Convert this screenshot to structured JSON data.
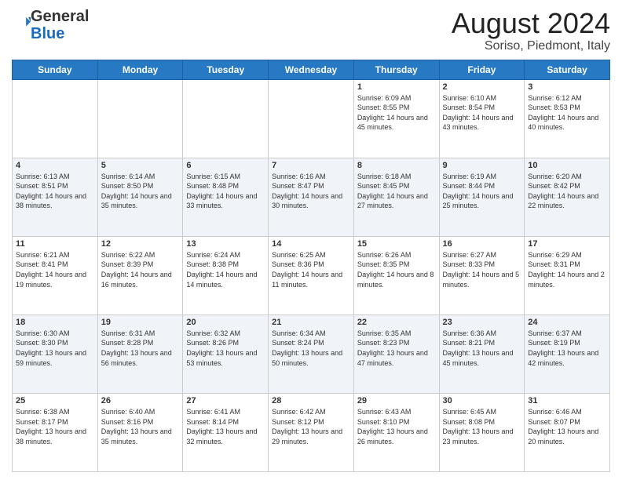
{
  "header": {
    "logo_general": "General",
    "logo_blue": "Blue",
    "month_year": "August 2024",
    "location": "Soriso, Piedmont, Italy"
  },
  "days_of_week": [
    "Sunday",
    "Monday",
    "Tuesday",
    "Wednesday",
    "Thursday",
    "Friday",
    "Saturday"
  ],
  "weeks": [
    [
      {
        "day": "",
        "info": ""
      },
      {
        "day": "",
        "info": ""
      },
      {
        "day": "",
        "info": ""
      },
      {
        "day": "",
        "info": ""
      },
      {
        "day": "1",
        "info": "Sunrise: 6:09 AM\nSunset: 8:55 PM\nDaylight: 14 hours and 45 minutes."
      },
      {
        "day": "2",
        "info": "Sunrise: 6:10 AM\nSunset: 8:54 PM\nDaylight: 14 hours and 43 minutes."
      },
      {
        "day": "3",
        "info": "Sunrise: 6:12 AM\nSunset: 8:53 PM\nDaylight: 14 hours and 40 minutes."
      }
    ],
    [
      {
        "day": "4",
        "info": "Sunrise: 6:13 AM\nSunset: 8:51 PM\nDaylight: 14 hours and 38 minutes."
      },
      {
        "day": "5",
        "info": "Sunrise: 6:14 AM\nSunset: 8:50 PM\nDaylight: 14 hours and 35 minutes."
      },
      {
        "day": "6",
        "info": "Sunrise: 6:15 AM\nSunset: 8:48 PM\nDaylight: 14 hours and 33 minutes."
      },
      {
        "day": "7",
        "info": "Sunrise: 6:16 AM\nSunset: 8:47 PM\nDaylight: 14 hours and 30 minutes."
      },
      {
        "day": "8",
        "info": "Sunrise: 6:18 AM\nSunset: 8:45 PM\nDaylight: 14 hours and 27 minutes."
      },
      {
        "day": "9",
        "info": "Sunrise: 6:19 AM\nSunset: 8:44 PM\nDaylight: 14 hours and 25 minutes."
      },
      {
        "day": "10",
        "info": "Sunrise: 6:20 AM\nSunset: 8:42 PM\nDaylight: 14 hours and 22 minutes."
      }
    ],
    [
      {
        "day": "11",
        "info": "Sunrise: 6:21 AM\nSunset: 8:41 PM\nDaylight: 14 hours and 19 minutes."
      },
      {
        "day": "12",
        "info": "Sunrise: 6:22 AM\nSunset: 8:39 PM\nDaylight: 14 hours and 16 minutes."
      },
      {
        "day": "13",
        "info": "Sunrise: 6:24 AM\nSunset: 8:38 PM\nDaylight: 14 hours and 14 minutes."
      },
      {
        "day": "14",
        "info": "Sunrise: 6:25 AM\nSunset: 8:36 PM\nDaylight: 14 hours and 11 minutes."
      },
      {
        "day": "15",
        "info": "Sunrise: 6:26 AM\nSunset: 8:35 PM\nDaylight: 14 hours and 8 minutes."
      },
      {
        "day": "16",
        "info": "Sunrise: 6:27 AM\nSunset: 8:33 PM\nDaylight: 14 hours and 5 minutes."
      },
      {
        "day": "17",
        "info": "Sunrise: 6:29 AM\nSunset: 8:31 PM\nDaylight: 14 hours and 2 minutes."
      }
    ],
    [
      {
        "day": "18",
        "info": "Sunrise: 6:30 AM\nSunset: 8:30 PM\nDaylight: 13 hours and 59 minutes."
      },
      {
        "day": "19",
        "info": "Sunrise: 6:31 AM\nSunset: 8:28 PM\nDaylight: 13 hours and 56 minutes."
      },
      {
        "day": "20",
        "info": "Sunrise: 6:32 AM\nSunset: 8:26 PM\nDaylight: 13 hours and 53 minutes."
      },
      {
        "day": "21",
        "info": "Sunrise: 6:34 AM\nSunset: 8:24 PM\nDaylight: 13 hours and 50 minutes."
      },
      {
        "day": "22",
        "info": "Sunrise: 6:35 AM\nSunset: 8:23 PM\nDaylight: 13 hours and 47 minutes."
      },
      {
        "day": "23",
        "info": "Sunrise: 6:36 AM\nSunset: 8:21 PM\nDaylight: 13 hours and 45 minutes."
      },
      {
        "day": "24",
        "info": "Sunrise: 6:37 AM\nSunset: 8:19 PM\nDaylight: 13 hours and 42 minutes."
      }
    ],
    [
      {
        "day": "25",
        "info": "Sunrise: 6:38 AM\nSunset: 8:17 PM\nDaylight: 13 hours and 38 minutes."
      },
      {
        "day": "26",
        "info": "Sunrise: 6:40 AM\nSunset: 8:16 PM\nDaylight: 13 hours and 35 minutes."
      },
      {
        "day": "27",
        "info": "Sunrise: 6:41 AM\nSunset: 8:14 PM\nDaylight: 13 hours and 32 minutes."
      },
      {
        "day": "28",
        "info": "Sunrise: 6:42 AM\nSunset: 8:12 PM\nDaylight: 13 hours and 29 minutes."
      },
      {
        "day": "29",
        "info": "Sunrise: 6:43 AM\nSunset: 8:10 PM\nDaylight: 13 hours and 26 minutes."
      },
      {
        "day": "30",
        "info": "Sunrise: 6:45 AM\nSunset: 8:08 PM\nDaylight: 13 hours and 23 minutes."
      },
      {
        "day": "31",
        "info": "Sunrise: 6:46 AM\nSunset: 8:07 PM\nDaylight: 13 hours and 20 minutes."
      }
    ]
  ]
}
